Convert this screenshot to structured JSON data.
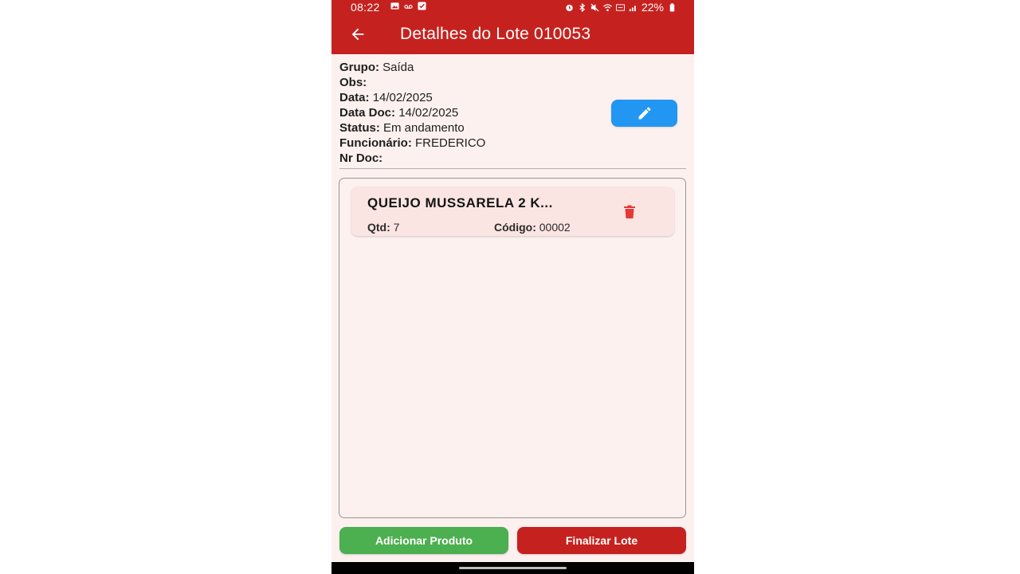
{
  "status_bar": {
    "time": "08:22",
    "battery": "22%"
  },
  "header": {
    "title": "Detalhes do Lote 010053",
    "back_icon": "arrow-left-icon"
  },
  "details": {
    "grupo_label": "Grupo:",
    "grupo_value": "Saída",
    "obs_label": "Obs:",
    "obs_value": "",
    "data_label": "Data:",
    "data_value": "14/02/2025",
    "data_doc_label": "Data Doc:",
    "data_doc_value": "14/02/2025",
    "status_label": "Status:",
    "status_value": "Em andamento",
    "funcionario_label": "Funcionário:",
    "funcionario_value": "FREDERICO",
    "nr_doc_label": "Nr Doc:",
    "nr_doc_value": ""
  },
  "edit_button": {
    "icon": "pencil-icon",
    "color": "#2196f3"
  },
  "products": [
    {
      "name": "QUEIJO MUSSARELA 2 K...",
      "qtd_label": "Qtd:",
      "qtd_value": "7",
      "code_label": "Código:",
      "code_value": "00002",
      "delete_icon": "trash-icon"
    }
  ],
  "actions": {
    "add_product": "Adicionar Produto",
    "finish_lot": "Finalizar Lote"
  },
  "colors": {
    "primary": "#c5221f",
    "add": "#4caf50",
    "edit": "#2196f3",
    "delete": "#e53935",
    "background": "#fdf1ef"
  }
}
